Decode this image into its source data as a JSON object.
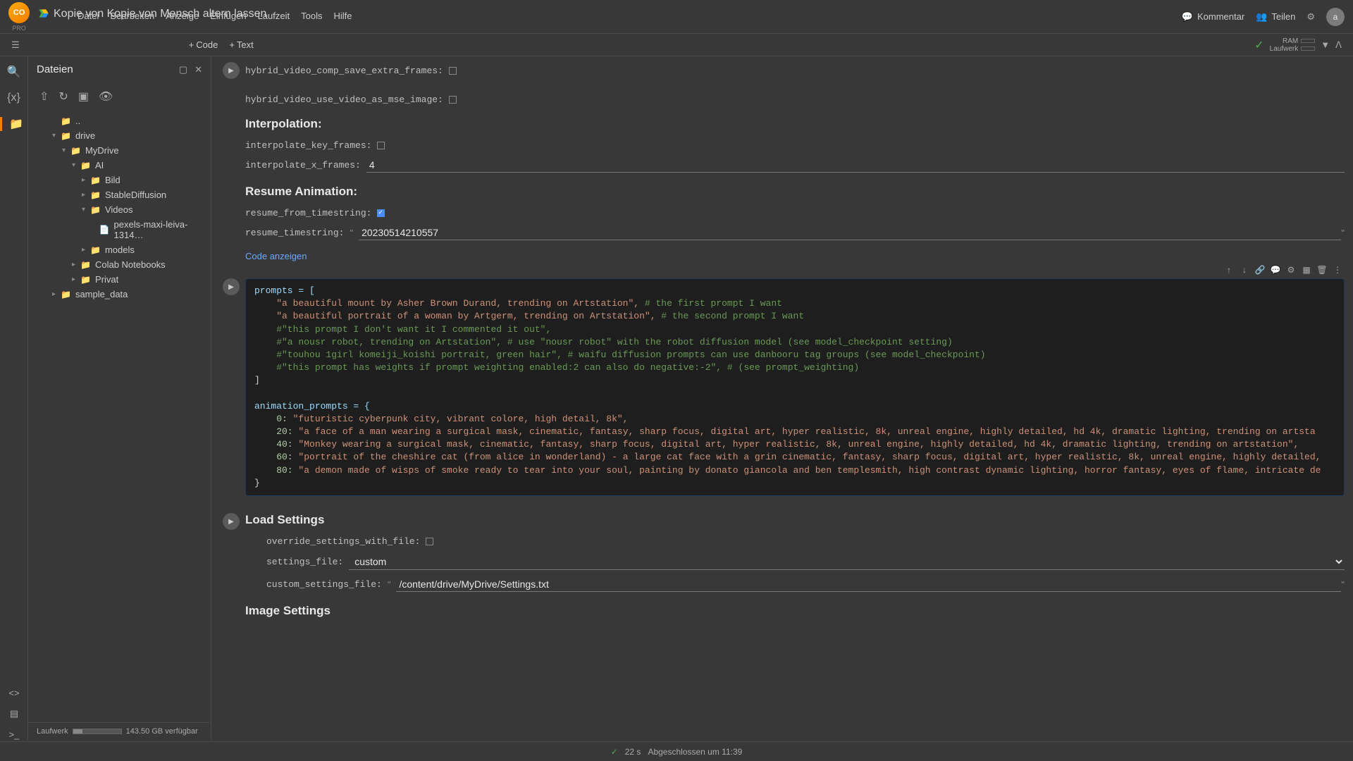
{
  "header": {
    "logo_text": "CO",
    "pro_label": "PRO",
    "doc_title": "Kopie von Kopie von Mensch altern lassen",
    "kommentar": "Kommentar",
    "teilen": "Teilen",
    "avatar_letter": "a"
  },
  "menu": [
    "Datei",
    "Bearbeiten",
    "Anzeige",
    "Einfügen",
    "Laufzeit",
    "Tools",
    "Hilfe"
  ],
  "toolbar": {
    "code_label": "Code",
    "text_label": "Text",
    "ram_label": "RAM",
    "laufwerk_label": "Laufwerk"
  },
  "sidebar": {
    "title": "Dateien",
    "disk_label": "Laufwerk",
    "disk_text": "143.50 GB verfügbar",
    "tree": {
      "up": "..",
      "drive": "drive",
      "mydrive": "MyDrive",
      "ai": "AI",
      "bild": "Bild",
      "stablediffusion": "StableDiffusion",
      "videos": "Videos",
      "pexels": "pexels-maxi-leiva-1314…",
      "models": "models",
      "colab": "Colab Notebooks",
      "privat": "Privat",
      "sample": "sample_data"
    }
  },
  "form": {
    "hybrid_save": "hybrid_video_comp_save_extra_frames:",
    "hybrid_mse": "hybrid_video_use_video_as_mse_image:",
    "interp_heading": "Interpolation:",
    "interp_key": "interpolate_key_frames:",
    "interp_x": "interpolate_x_frames:",
    "interp_x_val": "4",
    "resume_heading": "Resume Animation:",
    "resume_from": "resume_from_timestring:",
    "resume_ts": "resume_timestring:",
    "resume_ts_val": "20230514210557",
    "show_code": "Code anzeigen",
    "load_heading": "Load Settings",
    "override": "override_settings_with_file:",
    "settings_file": "settings_file:",
    "settings_file_val": "custom",
    "custom_file": "custom_settings_file:",
    "custom_file_val": "/content/drive/MyDrive/Settings.txt",
    "image_heading": "Image Settings"
  },
  "code": {
    "prompts_open": "prompts = [",
    "l2": "    \"a beautiful mount by Asher Brown Durand, trending on Artstation\",",
    "l2c": " # the first prompt I want",
    "l3": "    \"a beautiful portrait of a woman by Artgerm, trending on Artstation\",",
    "l3c": " # the second prompt I want",
    "l4": "    #\"this prompt I don't want it I commented it out\",",
    "l5": "    #\"a nousr robot, trending on Artstation\", # use \"nousr robot\" with the robot diffusion model (see model_checkpoint setting)",
    "l6": "    #\"touhou 1girl komeiji_koishi portrait, green hair\", # waifu diffusion prompts can use danbooru tag groups (see model_checkpoint)",
    "l7": "    #\"this prompt has weights if prompt weighting enabled:2 can also do negative:-2\", # (see prompt_weighting)",
    "l8": "]",
    "l9": "",
    "l10": "animation_prompts = {",
    "l11k": "    0: ",
    "l11s": "\"futuristic cyberpunk city, vibrant colore, high detail, 8k\",",
    "l12k": "    20: ",
    "l12s": "\"a face of a man wearing a surgical mask, cinematic, fantasy, sharp focus, digital art, hyper realistic, 8k, unreal engine, highly detailed, hd 4k, dramatic lighting, trending on artsta",
    "l13k": "    40: ",
    "l13s": "\"Monkey wearing a surgical mask, cinematic, fantasy, sharp focus, digital art, hyper realistic, 8k, unreal engine, highly detailed, hd 4k, dramatic lighting, trending on artstation\",",
    "l14k": "    60: ",
    "l14s": "\"portrait of the cheshire cat (from alice in wonderland) - a large cat face with a grin cinematic, fantasy, sharp focus, digital art, hyper realistic, 8k, unreal engine, highly detailed,",
    "l15k": "    80: ",
    "l15s": "\"a demon made of wisps of smoke ready to tear into your soul, painting by donato giancola and ben templesmith, high contrast dynamic lighting, horror fantasy, eyes of flame, intricate de",
    "l16": "}"
  },
  "status": {
    "time": "22 s",
    "text": "Abgeschlossen um 11:39"
  }
}
